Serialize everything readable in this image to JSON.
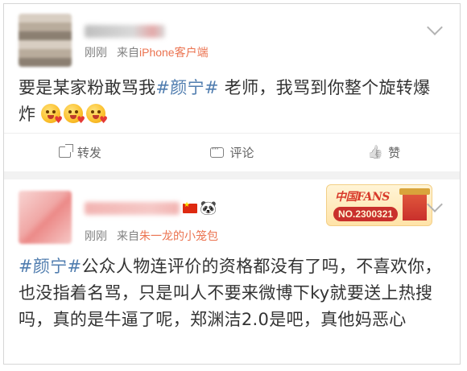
{
  "posts": [
    {
      "time": "刚刚",
      "source_prefix": "来自",
      "source": "iPhone客户端",
      "content_before_tag": "要是某家粉敢骂我",
      "hashtag": "#颜宁#",
      "content_after_tag": " 老师，我骂到你整个旋转爆炸",
      "emoji_count": 3,
      "actions": {
        "share": "转发",
        "comment": "评论",
        "like": "赞"
      }
    },
    {
      "time": "刚刚",
      "source_prefix": "来自",
      "source": "朱一龙的小笼包",
      "badge_title": "中国FANS",
      "badge_number": "NO.2300321",
      "hashtag": "#颜宁#",
      "content_after_tag": "公众人物连评价的资格都没有了吗，不喜欢你，也没指着名骂，只是叫人不要来微博下ky就要送上热搜吗，真的是牛逼了呢，郑渊洁2.0是吧，真他妈恶心"
    }
  ],
  "colors": {
    "hashtag": "#507daf",
    "source": "#eb7350",
    "meta": "#808080"
  }
}
